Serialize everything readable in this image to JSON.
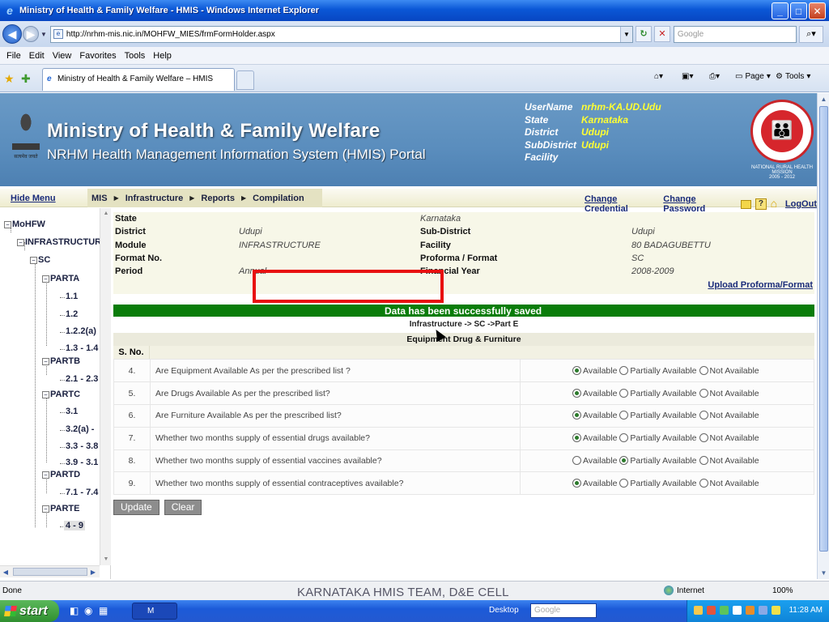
{
  "window": {
    "title": "Ministry of Health & Family Welfare - HMIS - Windows Internet Explorer"
  },
  "address": {
    "url": "http://nrhm-mis.nic.in/MOHFW_MIES/frmFormHolder.aspx",
    "search_placeholder": "Google"
  },
  "menu": [
    "File",
    "Edit",
    "View",
    "Favorites",
    "Tools",
    "Help"
  ],
  "tab": {
    "title": "Ministry of Health & Family Welfare – HMIS"
  },
  "commands": {
    "page": "Page",
    "tools": "Tools"
  },
  "header": {
    "title": "Ministry of Health & Family Welfare",
    "subtitle": "NRHM Health Management Information System (HMIS) Portal",
    "user": {
      "labels": [
        "UserName",
        "State",
        "District",
        "SubDistrict",
        "Facility"
      ],
      "values": [
        "nrhm-KA.UD.Udu",
        "Karnataka",
        "Udupi",
        "Udupi",
        ""
      ]
    },
    "logo_text": "NATIONAL RURAL HEALTH MISSION",
    "logo_years": "2005 - 2012",
    "emblem_motto": "सत्यमेव जयते"
  },
  "nav": {
    "hide_menu": "Hide Menu",
    "items": [
      "MIS",
      "Infrastructure",
      "Reports",
      "Compilation"
    ],
    "change_credential": "Change Credential",
    "change_password": "Change Password",
    "logout": "LogOut"
  },
  "tree": {
    "root": "MoHFW",
    "infra": "INFRASTRUCTURE",
    "sc": "SC",
    "parta": "PARTA",
    "a1": "1.1",
    "a2": "1.2",
    "a3": "1.2.2(a)",
    "a4": "1.3 - 1.4",
    "partb": "PARTB",
    "b1": "2.1 - 2.3",
    "partc": "PARTC",
    "c1": "3.1",
    "c2": "3.2(a) -",
    "c3": "3.3 - 3.8",
    "c4": "3.9 - 3.1",
    "partd": "PARTD",
    "d1": "7.1 - 7.4",
    "parte": "PARTE",
    "e1": "4 - 9"
  },
  "info": {
    "state_label": "State",
    "state_value": "Karnataka",
    "district_label": "District",
    "district_value": "Udupi",
    "subdistrict_label": "Sub-District",
    "subdistrict_value": "Udupi",
    "module_label": "Module",
    "module_value": "INFRASTRUCTURE",
    "facility_label": "Facility",
    "facility_value": "80 BADAGUBETTU",
    "format_label": "Format No.",
    "format_value": "",
    "proforma_label": "Proforma / Format",
    "proforma_value": "SC",
    "period_label": "Period",
    "period_value": "Annual",
    "fy_label": "Financial Year",
    "fy_value": "2008-2009",
    "upload_link": "Upload Proforma/Format"
  },
  "status": {
    "success_message": "Data has been successfully saved",
    "path": "Infrastructure -> SC ->Part E"
  },
  "section": {
    "title": "Equipment Drug & Furniture",
    "sno_header": "S. No."
  },
  "options": [
    "Available",
    "Partially Available",
    "Not Available"
  ],
  "questions": [
    {
      "sno": "4.",
      "text": "Are Equipment Available As per the prescribed list ?",
      "selected": 0
    },
    {
      "sno": "5.",
      "text": "Are Drugs Available As per the prescribed list?",
      "selected": 0
    },
    {
      "sno": "6.",
      "text": "Are Furniture Available As per the prescribed list?",
      "selected": 0
    },
    {
      "sno": "7.",
      "text": "Whether two months supply of essential drugs available?",
      "selected": 0
    },
    {
      "sno": "8.",
      "text": "Whether two months supply of essential vaccines available?",
      "selected": 1
    },
    {
      "sno": "9.",
      "text": "Whether two months supply of essential contraceptives available?",
      "selected": 0
    }
  ],
  "buttons": {
    "update": "Update",
    "clear": "Clear"
  },
  "statusbar": {
    "done": "Done",
    "overlay": "KARNATAKA HMIS TEAM, D&E CELL",
    "zone": "Internet",
    "zoom": "100%"
  },
  "taskbar": {
    "start": "start",
    "task_label": "M",
    "desktop": "Desktop",
    "search_placeholder": "Google",
    "clock": "11:28 AM"
  }
}
